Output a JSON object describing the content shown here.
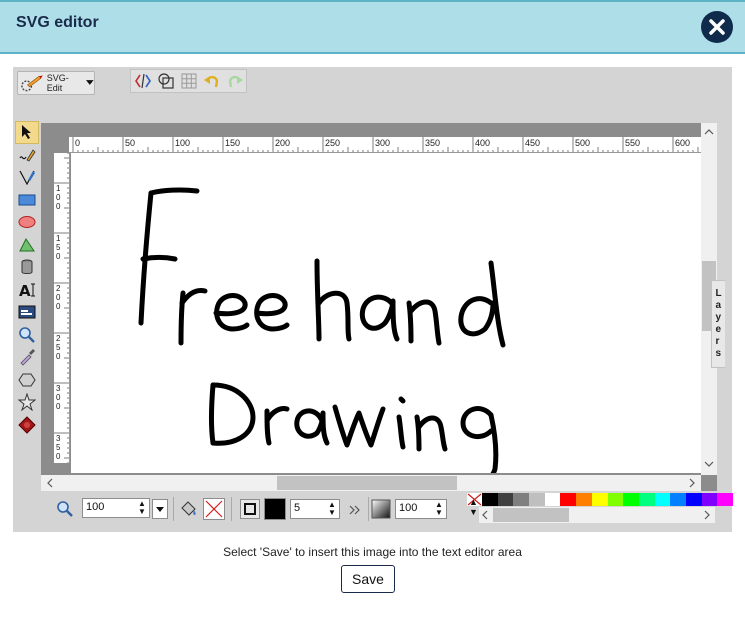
{
  "dialog": {
    "title": "SVG editor"
  },
  "editor": {
    "menu_label": "SVG-Edit",
    "layers_label": "Layers",
    "ruler_top_labels": [
      "0",
      "50",
      "100",
      "150",
      "200",
      "250",
      "300",
      "350",
      "400",
      "450",
      "500",
      "550",
      "600"
    ],
    "ruler_left_labels": [
      "1\n0\n0",
      "1\n5\n0",
      "2\n0\n0",
      "2\n5\n0",
      "3\n0\n0",
      "3\n5\n0"
    ],
    "zoom_value": "100",
    "stroke_width_value": "5",
    "opacity_value": "100",
    "palette_colors": [
      "#000000",
      "#3f3f3f",
      "#7f7f7f",
      "#bfbfbf",
      "#ffffff",
      "#ff0000",
      "#ff7f00",
      "#ffff00",
      "#7fff00",
      "#00ff00",
      "#00ff7f",
      "#00ffff",
      "#007fff",
      "#0000ff",
      "#7f00ff",
      "#ff00ff"
    ]
  },
  "footer": {
    "hint": "Select 'Save' to insert this image into the text editor area",
    "save_label": "Save"
  }
}
